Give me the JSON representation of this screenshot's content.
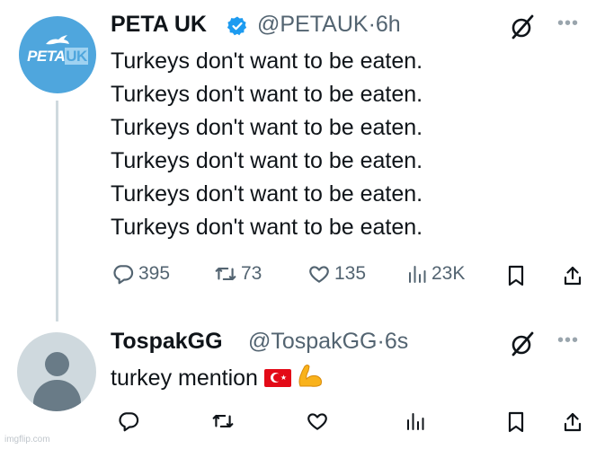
{
  "tweet1": {
    "display_name": "PETA UK",
    "verified_icon": "verified-badge-icon",
    "handle": "@PETAUK",
    "separator": "·",
    "time": "6h",
    "avatar": {
      "logo_text_main": "PETA",
      "logo_text_accent": "UK",
      "icon": "peta-rabbit-logo"
    },
    "lines": [
      "Turkeys don't want to be eaten.",
      "Turkeys don't want to be eaten.",
      "Turkeys don't want to be eaten.",
      "Turkeys don't want to be eaten.",
      "Turkeys don't want to be eaten.",
      "Turkeys don't want to be eaten."
    ],
    "actions": {
      "replies": "395",
      "retweets": "73",
      "likes": "135",
      "views": "23K"
    }
  },
  "tweet2": {
    "display_name": "TospakGG",
    "handle": "@TospakGG",
    "separator": "·",
    "time": "6s",
    "text": "turkey mention",
    "emojis": [
      "turkey-flag-icon",
      "flexed-biceps-icon"
    ]
  },
  "more_label": "•••",
  "watermark": "imgflip.com",
  "colors": {
    "accent": "#1d9bf0",
    "muted": "#536471",
    "peta_blue": "#4fa6dd"
  }
}
